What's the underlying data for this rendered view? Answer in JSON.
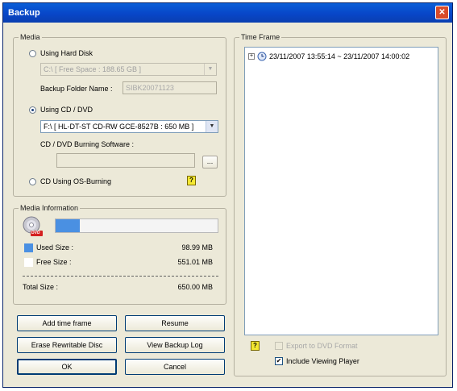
{
  "window": {
    "title": "Backup",
    "close_glyph": "✕"
  },
  "media": {
    "legend": "Media",
    "hard_disk": {
      "label": "Using Hard Disk",
      "drive_value": "C:\\ [ Free Space : 188.65 GB ]",
      "selected": false
    },
    "folder": {
      "label": "Backup Folder Name :",
      "value": "SIBK20071123"
    },
    "cd_dvd": {
      "label": "Using CD / DVD",
      "drive_value": "F:\\ [ HL-DT-ST CD-RW GCE-8527B : 650 MB ]",
      "selected": true
    },
    "burning_software": {
      "label": "CD / DVD Burning Software :",
      "value": "",
      "browse_label": "..."
    },
    "os_burning": {
      "label": "CD Using OS-Burning",
      "selected": false
    }
  },
  "media_info": {
    "legend": "Media Information",
    "disc_badge": "DVD",
    "used_fraction": 0.15,
    "used_label": "Used Size :",
    "used_value": "98.99 MB",
    "free_label": "Free Size :",
    "free_value": "551.01 MB",
    "total_label": "Total Size :",
    "total_value": "650.00 MB",
    "colors": {
      "used": "#4a90e2",
      "free": "#ffffff"
    }
  },
  "time_frame": {
    "legend": "Time Frame",
    "items": [
      {
        "expander": "+",
        "label": "23/11/2007 13:55:14 ~ 23/11/2007 14:00:02"
      }
    ]
  },
  "options": {
    "export_dvd": {
      "label": "Export to DVD Format",
      "checked": false,
      "enabled": false
    },
    "include_player": {
      "label": "Include Viewing Player",
      "checked": true,
      "check_glyph": "✔"
    }
  },
  "buttons": {
    "add_time_frame": "Add time frame",
    "resume": "Resume",
    "erase": "Erase Rewritable Disc",
    "view_log": "View Backup Log",
    "ok": "OK",
    "cancel": "Cancel"
  },
  "help_glyph": "?"
}
